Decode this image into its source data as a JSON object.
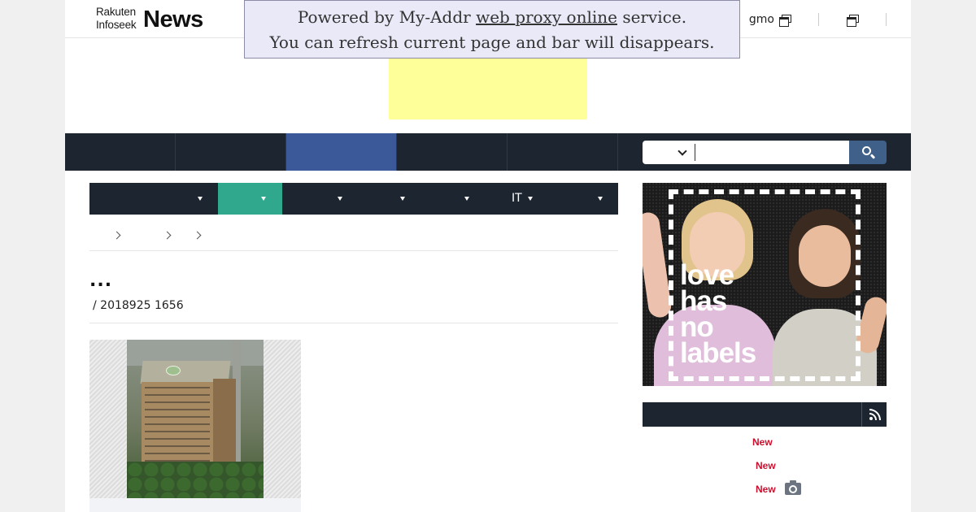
{
  "header": {
    "logo_line1": "Rakuten",
    "logo_line2": "Infoseek",
    "logo_main": "News",
    "user_text": "gmo"
  },
  "proxy_bar": {
    "line1_before": "Powered by My-Addr ",
    "line1_link": "web proxy online",
    "line1_after": " service.",
    "line2": "You can refresh current page and bar will disappears."
  },
  "sub_nav": {
    "it_label": "IT"
  },
  "article": {
    "title": "...",
    "meta": "/ 2018925 1656"
  },
  "side_ad": {
    "text_lines": [
      "love",
      "has",
      "no",
      "labels"
    ]
  },
  "ranking": {
    "badges": [
      "New",
      "New",
      "New"
    ]
  },
  "colors": {
    "nav_bg": "#1c2530",
    "nav_active": "#3b5998",
    "sub_active": "#2fa88e",
    "new_badge": "#c8102e",
    "ad_yellow": "#ffff99",
    "search_button": "#3f6088"
  },
  "icons": [
    "new-window-icon",
    "chevron-down-icon",
    "search-icon",
    "caret-down-icon",
    "chevron-right-icon",
    "rss-icon",
    "camera-icon"
  ]
}
